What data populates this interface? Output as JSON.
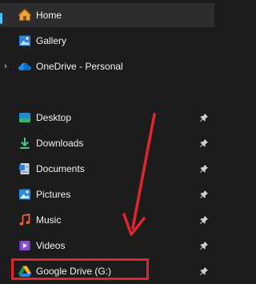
{
  "nav": {
    "items": [
      {
        "label": "Home",
        "icon": "home-icon",
        "selected": true,
        "pinned": false,
        "expandable": false
      },
      {
        "label": "Gallery",
        "icon": "gallery-icon",
        "selected": false,
        "pinned": false,
        "expandable": false
      },
      {
        "label": "OneDrive - Personal",
        "icon": "onedrive-cloud-icon",
        "selected": false,
        "pinned": false,
        "expandable": true
      },
      {
        "label": "Desktop",
        "icon": "desktop-icon",
        "selected": false,
        "pinned": true,
        "expandable": false
      },
      {
        "label": "Downloads",
        "icon": "downloads-icon",
        "selected": false,
        "pinned": true,
        "expandable": false
      },
      {
        "label": "Documents",
        "icon": "documents-icon",
        "selected": false,
        "pinned": true,
        "expandable": false
      },
      {
        "label": "Pictures",
        "icon": "pictures-icon",
        "selected": false,
        "pinned": true,
        "expandable": false
      },
      {
        "label": "Music",
        "icon": "music-icon",
        "selected": false,
        "pinned": true,
        "expandable": false
      },
      {
        "label": "Videos",
        "icon": "videos-icon",
        "selected": false,
        "pinned": true,
        "expandable": false
      },
      {
        "label": "Google Drive (G:)",
        "icon": "google-drive-icon",
        "selected": false,
        "pinned": true,
        "expandable": false
      }
    ],
    "expand_glyph": "›"
  },
  "annotation": {
    "highlight_color": "#e0262c",
    "arrow_color": "#e0262c"
  },
  "colors": {
    "background": "#1c1c1c",
    "selected_background": "#2d2d2d",
    "accent": "#4cc2ff",
    "text": "#f2f2f2"
  }
}
